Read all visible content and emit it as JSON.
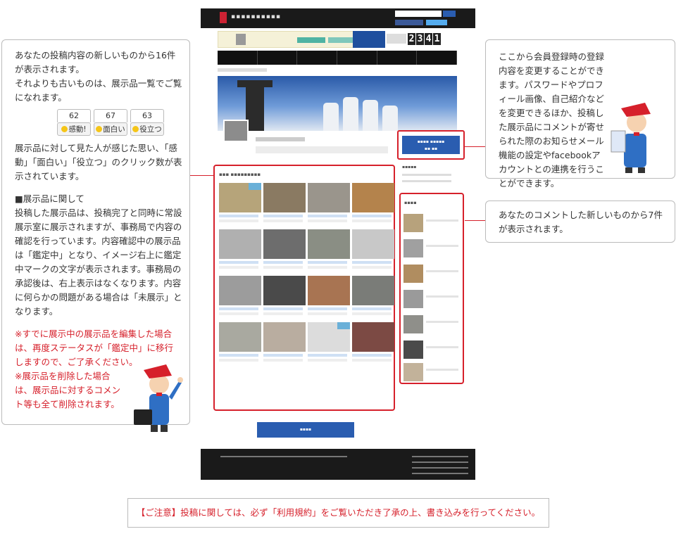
{
  "left_callout": {
    "intro_1": "あなたの投稿内容の新しいものから16件が表示されます。",
    "intro_2": "それよりも古いものは、展示品一覧でご覧になれます。",
    "reactions": [
      {
        "count": "62",
        "label": "感動!"
      },
      {
        "count": "67",
        "label": "面白い"
      },
      {
        "count": "63",
        "label": "役立つ"
      }
    ],
    "reaction_desc": "展示品に対して見た人が感じた思い、「感動」「面白い」「役立つ」のクリック数が表示されています。",
    "section_heading": "■展示品に関して",
    "section_body": "投稿した展示品は、投稿完了と同時に常設展示室に展示されますが、事務局で内容の確認を行っています。内容確認中の展示品は「鑑定中」となり、イメージ右上に鑑定中マークの文字が表示されます。事務局の承認後は、右上表示はなくなります。内容に何らかの問題がある場合は「未展示」となります。",
    "warning_1": "※すでに展示中の展示品を編集した場合は、再度ステータスが「鑑定中」に移行しますので、ご了承ください。",
    "warning_2": "※展示品を削除した場合は、展示品に対するコメント等も全て削除されます。"
  },
  "top_right_callout": {
    "text": "ここから会員登録時の登録内容を変更することができます。パスワードやプロフィール画像、自己紹介などを変更できるほか、投稿した展示品にコメントが寄せられた際のお知らせメール機能の設定やfacebookアカウントとの連携を行うことができます。"
  },
  "mid_right_callout": {
    "text": "あなたのコメントした新しいものから7件が表示されます。"
  },
  "page_mock": {
    "counter_digits": [
      "2",
      "3",
      "4",
      "1"
    ]
  },
  "notice": {
    "text": "【ご注意】投稿に関しては、必ず「利用規約」をご覧いただき了承の上、書き込みを行ってください。"
  },
  "colors": {
    "accent_red": "#d6202b",
    "button_blue": "#2a5db0"
  }
}
